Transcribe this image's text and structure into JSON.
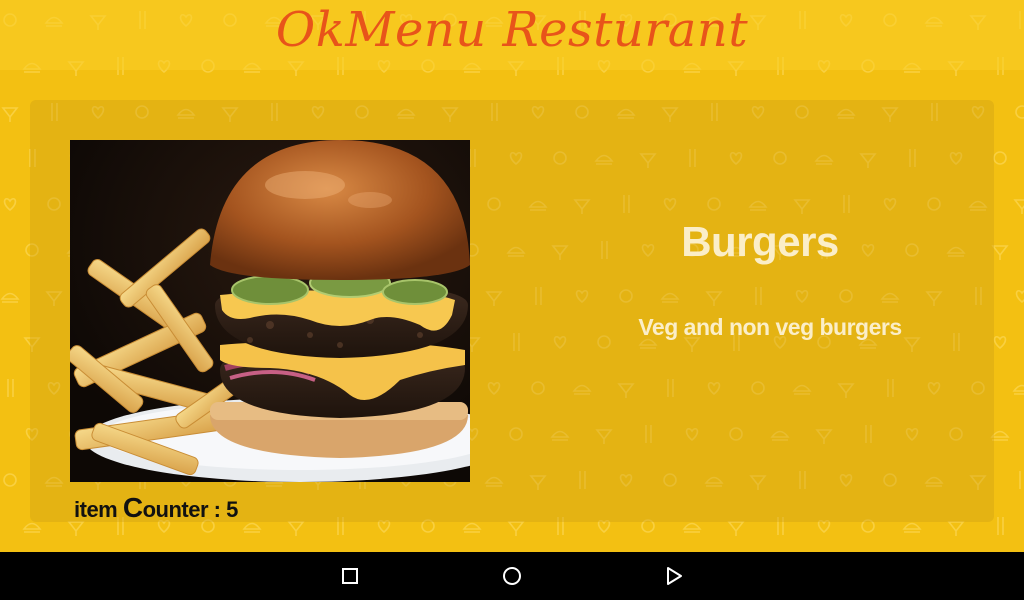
{
  "header": {
    "title": "OkMenu Resturant"
  },
  "menu_item": {
    "title": "Burgers",
    "description": "Veg and non veg burgers",
    "counter_label_prefix": "item ",
    "counter_label_big": "C",
    "counter_label_rest": "ounter : ",
    "counter_value": "5",
    "image_icon": "burger-photo"
  },
  "navigation": {
    "recents_icon": "square-icon",
    "home_icon": "circle-icon",
    "back_icon": "triangle-icon"
  },
  "colors": {
    "background": "#f3c012",
    "title": "#e8541a",
    "card_text": "#fbeec8",
    "nav_bar": "#000000"
  }
}
